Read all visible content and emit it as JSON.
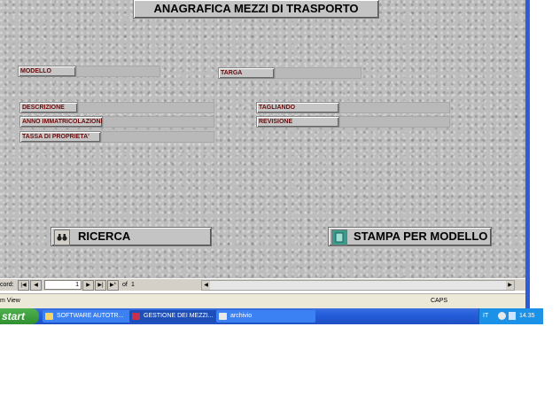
{
  "form": {
    "title": "ANAGRAFICA MEZZI DI TRASPORTO",
    "labels": {
      "modello": "MODELLO",
      "targa": "TARGA",
      "descrizione": "DESCRIZIONE",
      "anno": "ANNO IMMATRICOLAZIONE",
      "tassa": "TASSA DI PROPRIETA'",
      "tagliando": "TAGLIANDO",
      "revisione": "REVISIONE"
    },
    "buttons": {
      "ricerca": "RICERCA",
      "stampa": "STAMPA PER MODELLO"
    }
  },
  "nav": {
    "record_label": "cord:",
    "record_value": "1",
    "of_label": "of",
    "total": "1"
  },
  "status": {
    "view": "m View",
    "caps": "CAPS"
  },
  "taskbar": {
    "start": "start",
    "items": [
      "SOFTWARE AUTOTR...",
      "GESTIONE DEI MEZZI...",
      "archivio"
    ],
    "lang": "IT",
    "clock": "14.35"
  },
  "colors": {
    "label_text": "#6a0b0b",
    "taskbar": "#245edb",
    "start": "#3a9d3a"
  }
}
